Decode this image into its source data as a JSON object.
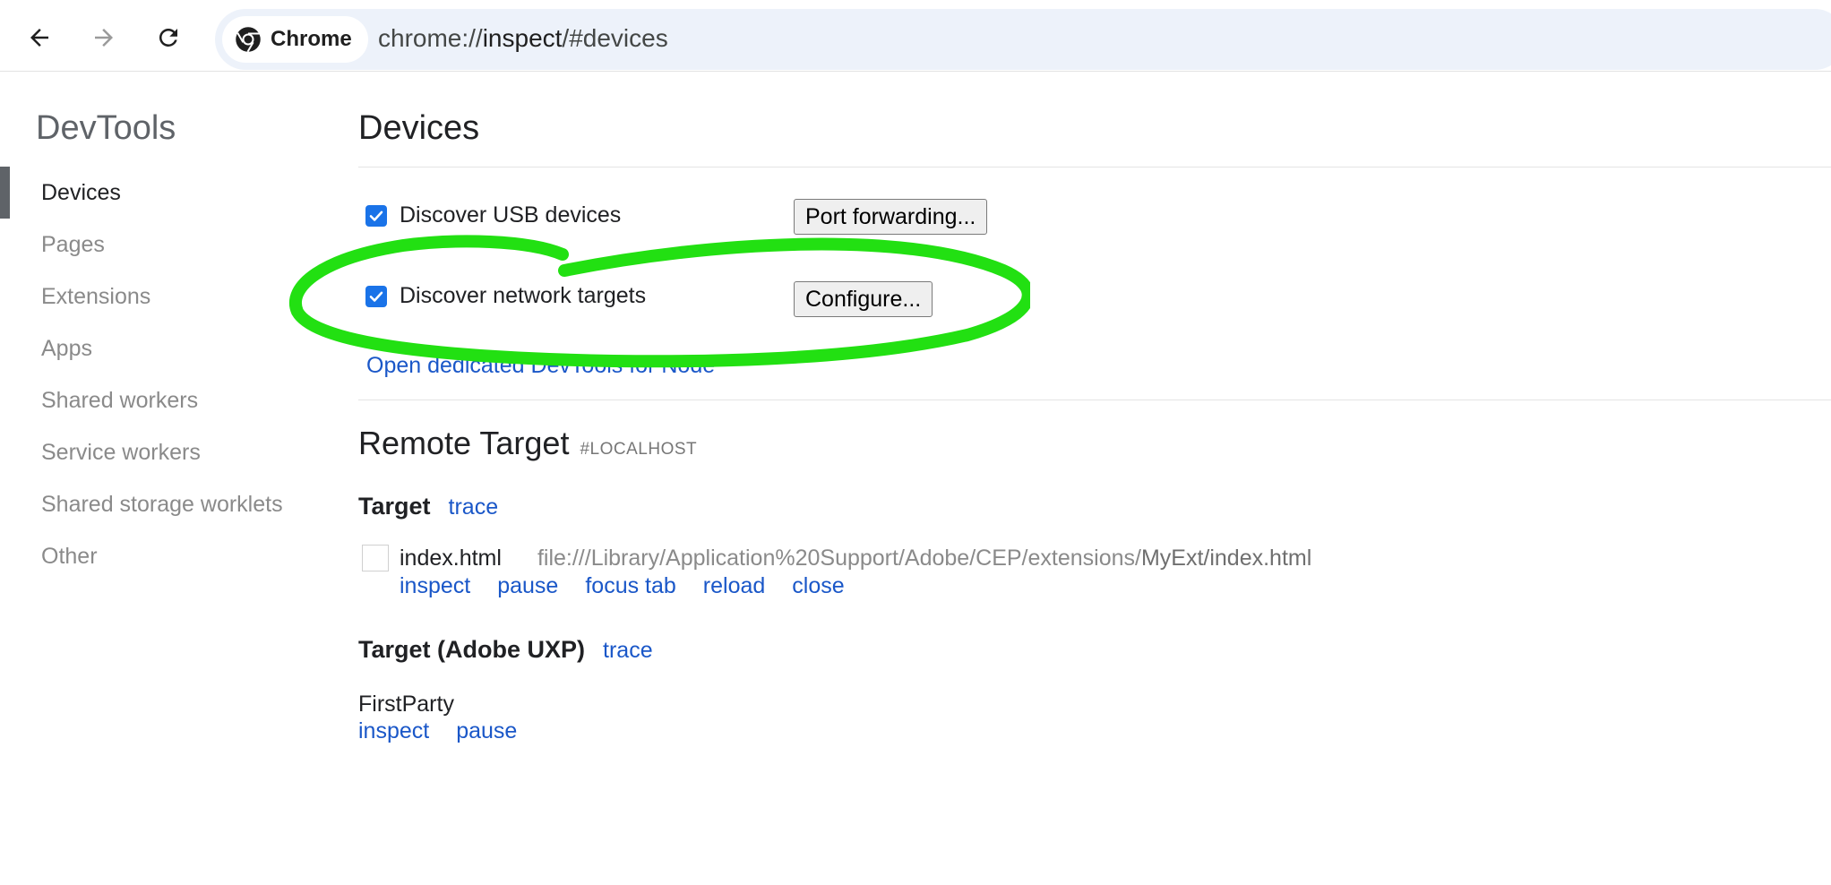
{
  "toolbar": {
    "chip_label": "Chrome",
    "url_prefix": "chrome://",
    "url_host": "inspect",
    "url_path": "/#devices"
  },
  "sidebar": {
    "title": "DevTools",
    "items": [
      {
        "label": "Devices",
        "selected": true
      },
      {
        "label": "Pages"
      },
      {
        "label": "Extensions"
      },
      {
        "label": "Apps"
      },
      {
        "label": "Shared workers"
      },
      {
        "label": "Service workers"
      },
      {
        "label": "Shared storage worklets"
      },
      {
        "label": "Other"
      }
    ]
  },
  "main": {
    "title": "Devices",
    "usb": {
      "label": "Discover USB devices",
      "checked": true,
      "button": "Port forwarding..."
    },
    "network": {
      "label": "Discover network targets",
      "checked": true,
      "button": "Configure..."
    },
    "node_link": "Open dedicated DevTools for Node",
    "remote": {
      "title": "Remote Target",
      "host": "#LOCALHOST"
    },
    "targets": [
      {
        "heading": "Target",
        "trace": "trace",
        "name": "index.html",
        "url_main": "file:///Library/Application%20Support/Adobe/CEP/extensions/",
        "url_tail": "MyExt/index.html",
        "actions": [
          "inspect",
          "pause",
          "focus tab",
          "reload",
          "close"
        ]
      },
      {
        "heading": "Target (Adobe UXP)",
        "trace": "trace",
        "name": "FirstParty",
        "actions": [
          "inspect",
          "pause"
        ]
      }
    ]
  },
  "colors": {
    "accent": "#1a73e8",
    "link": "#1a57c8",
    "annotation": "#22e012"
  }
}
